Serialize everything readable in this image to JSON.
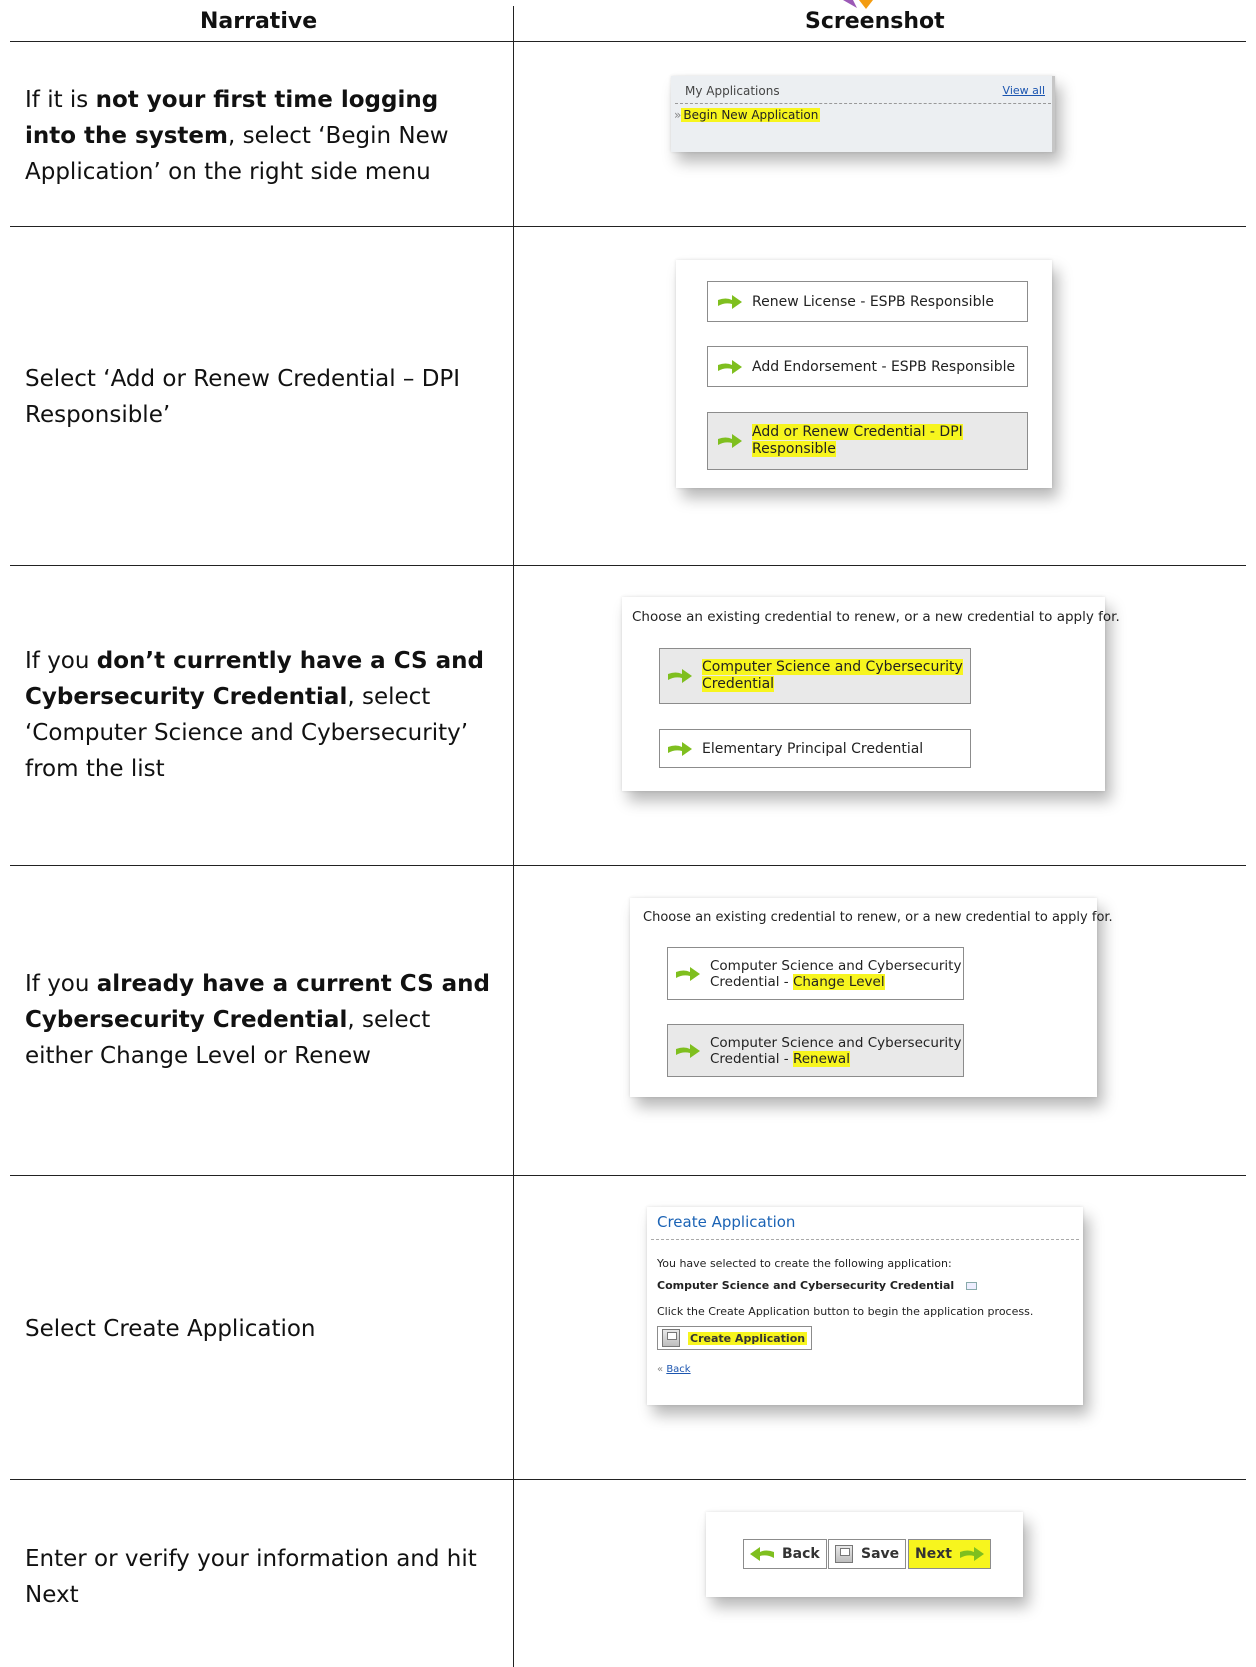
{
  "headers": {
    "narrative": "Narrative",
    "screenshot": "Screenshot"
  },
  "rows": [
    {
      "narrative": {
        "pre": "If it is ",
        "bold": "not your first time logging into the system",
        "post": ", select ‘Begin New Application’ on the right side menu"
      },
      "panel": {
        "title": "My Applications",
        "view_all": "View all",
        "item_prefix": "»",
        "item": "Begin New Application"
      }
    },
    {
      "narrative": {
        "pre": "Select ‘Add or Renew Credential – DPI Responsible’",
        "bold": "",
        "post": ""
      },
      "panel": {
        "buttons": [
          "Renew License - ESPB Responsible",
          "Add Endorsement - ESPB Responsible",
          "Add or Renew Credential - DPI",
          "Responsible"
        ]
      }
    },
    {
      "narrative": {
        "pre": "If you ",
        "bold": "don’t currently have a CS and Cybersecurity  Credential",
        "post": ", select ‘Computer Science and Cybersecurity’ from the list"
      },
      "panel": {
        "prompt": "Choose an existing credential to renew, or a new credential to apply for.",
        "buttons": [
          "Computer Science and Cybersecurity",
          "Credential",
          "Elementary Principal Credential"
        ]
      }
    },
    {
      "narrative": {
        "pre": "If you ",
        "bold": "already have a current CS and Cybersecurity Credential",
        "post": ", select either Change Level or Renew"
      },
      "panel": {
        "prompt": "Choose an existing credential to renew, or a new credential to apply for.",
        "btn1_line1": "Computer Science and Cybersecurity",
        "btn1_line2": "Credential - ",
        "btn1_hl": "Change Level",
        "btn2_line1": "Computer Science and Cybersecurity",
        "btn2_line2": "Credential - ",
        "btn2_hl": "Renewal"
      }
    },
    {
      "narrative": {
        "pre": "Select Create Application",
        "bold": "",
        "post": ""
      },
      "panel": {
        "title": "Create Application",
        "line1": "You have selected to create the following application:",
        "app_name": "Computer Science and Cybersecurity Credential",
        "line2": "Click the Create Application button to begin the application process.",
        "button": "Create Application",
        "back_prefix": "«",
        "back": "Back"
      }
    },
    {
      "narrative": {
        "pre": "Enter or verify your information and hit Next",
        "bold": "",
        "post": ""
      },
      "panel": {
        "back": "Back",
        "save": "Save",
        "next": "Next"
      }
    }
  ],
  "colors": {
    "highlight": "#f7f51e",
    "arrow": "#7fbf1f",
    "link": "#1b55b0",
    "title_blue": "#1b63b5"
  }
}
